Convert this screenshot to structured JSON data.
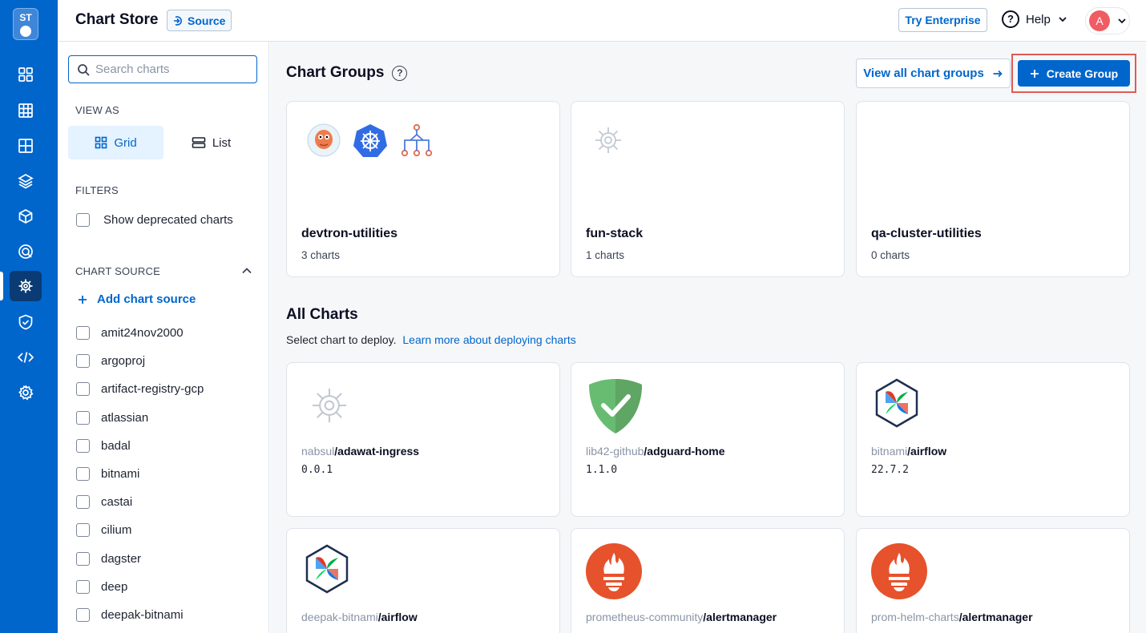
{
  "rail": {
    "logo_text": "ST"
  },
  "header": {
    "title": "Chart Store",
    "source_label": "Source",
    "try_enterprise": "Try Enterprise",
    "help": "Help",
    "avatar_initial": "A"
  },
  "sidebar": {
    "search_placeholder": "Search charts",
    "view_as_label": "VIEW AS",
    "view_grid": "Grid",
    "view_list": "List",
    "filters_label": "FILTERS",
    "show_deprecated": "Show deprecated charts",
    "chart_source_label": "CHART SOURCE",
    "add_chart_source": "Add chart source",
    "sources": [
      "amit24nov2000",
      "argoproj",
      "artifact-registry-gcp",
      "atlassian",
      "badal",
      "bitnami",
      "castai",
      "cilium",
      "dagster",
      "deep",
      "deepak-bitnami"
    ]
  },
  "main": {
    "chart_groups_title": "Chart Groups",
    "view_all_groups": "View all chart groups",
    "create_group": "Create Group",
    "groups": [
      {
        "name": "devtron-utilities",
        "count": "3 charts"
      },
      {
        "name": "fun-stack",
        "count": "1 charts"
      },
      {
        "name": "qa-cluster-utilities",
        "count": "0 charts"
      }
    ],
    "all_charts_title": "All Charts",
    "all_charts_sub": "Select chart to deploy.",
    "learn_more": "Learn more about deploying charts",
    "charts": [
      {
        "repo": "nabsul",
        "name": "/adawat-ingress",
        "version": "0.0.1"
      },
      {
        "repo": "lib42-github",
        "name": "/adguard-home",
        "version": "1.1.0"
      },
      {
        "repo": "bitnami",
        "name": "/airflow",
        "version": "22.7.2"
      },
      {
        "repo": "deepak-bitnami",
        "name": "/airflow",
        "version": ""
      },
      {
        "repo": "prometheus-community",
        "name": "/alertmanager",
        "version": ""
      },
      {
        "repo": "prom-helm-charts",
        "name": "/alertmanager",
        "version": ""
      }
    ]
  },
  "colors": {
    "rail": "#0066cc",
    "primary": "#0066cc",
    "highlight": "#e05a55",
    "prometheus": "#e6522c"
  }
}
